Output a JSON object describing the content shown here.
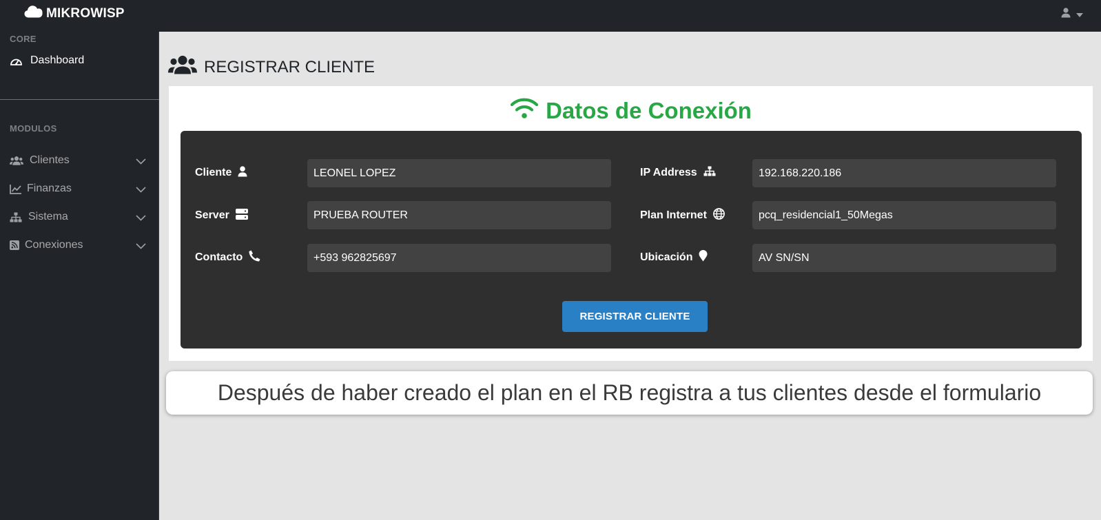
{
  "app": {
    "brand": "MIKROWISP"
  },
  "sidebar": {
    "core_heading": "CORE",
    "dashboard_label": "Dashboard",
    "modules_heading": "MODULOS",
    "items": [
      {
        "label": "Clientes",
        "icon": "users-icon"
      },
      {
        "label": "Finanzas",
        "icon": "chart-line-icon"
      },
      {
        "label": "Sistema",
        "icon": "sitemap-icon"
      },
      {
        "label": "Conexiones",
        "icon": "rss-square-icon"
      }
    ]
  },
  "page": {
    "title": "REGISTRAR CLIENTE"
  },
  "form": {
    "title": "Datos de Conexión",
    "cliente_label": "Cliente",
    "cliente_value": "LEONEL LOPEZ",
    "server_label": "Server",
    "server_value": "PRUEBA ROUTER",
    "contacto_label": "Contacto",
    "contacto_value": "+593 962825697",
    "ip_label": "IP Address",
    "ip_value": "192.168.220.186",
    "plan_label": "Plan Internet",
    "plan_value": "pcq_residencial1_50Megas",
    "ubicacion_label": "Ubicación",
    "ubicacion_value": "AV SN/SN",
    "submit_label": "REGISTRAR CLIENTE"
  },
  "caption": "Después de haber creado el plan en el RB registra a tus clientes desde el formulario",
  "colors": {
    "sidebar_bg": "#212529",
    "content_bg": "#e4e4e4",
    "panel_bg": "#2f2f2f",
    "input_bg": "#424242",
    "accent_green": "#28a745",
    "button_blue": "#2a80c4"
  }
}
